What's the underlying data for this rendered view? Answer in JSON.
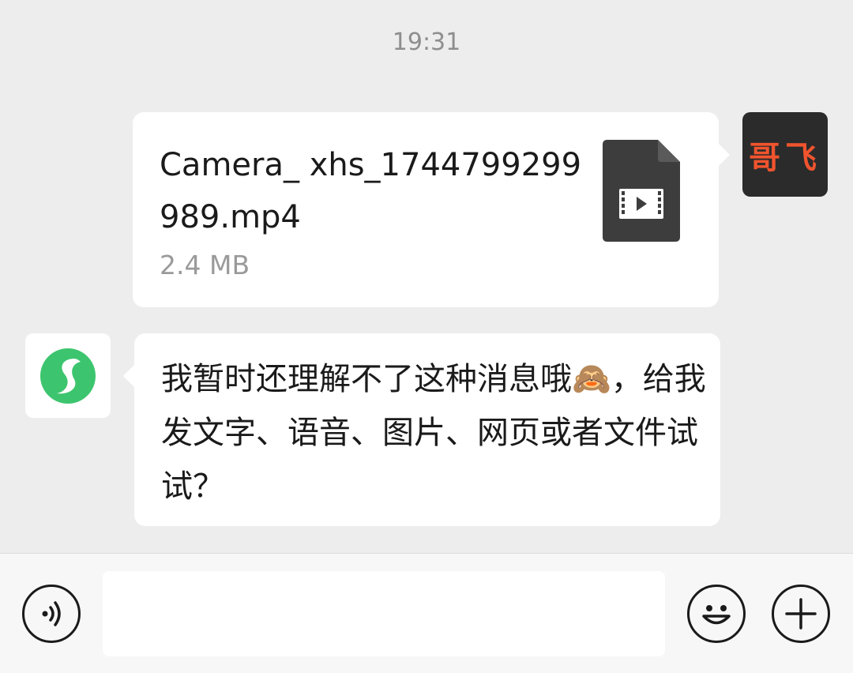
{
  "timestamp": "19:31",
  "me": {
    "avatar_text": "哥飞",
    "avatar_bg": "#2b2b2b",
    "avatar_fg": "#f0542e"
  },
  "file_message": {
    "file_name": "Camera_ xhs_1744799299989.mp4",
    "file_size": "2.4 MB",
    "icon": "video-file-icon"
  },
  "bot": {
    "avatar_icon": "bot-logo-icon",
    "avatar_color": "#3cc56e"
  },
  "reply_message": {
    "text": "我暂时还理解不了这种消息哦🙈，给我发文字、语音、图片、网页或者文件试试？"
  },
  "input_bar": {
    "voice_icon": "voice-icon",
    "input_value": "",
    "emoji_icon": "emoji-icon",
    "plus_icon": "plus-icon"
  }
}
